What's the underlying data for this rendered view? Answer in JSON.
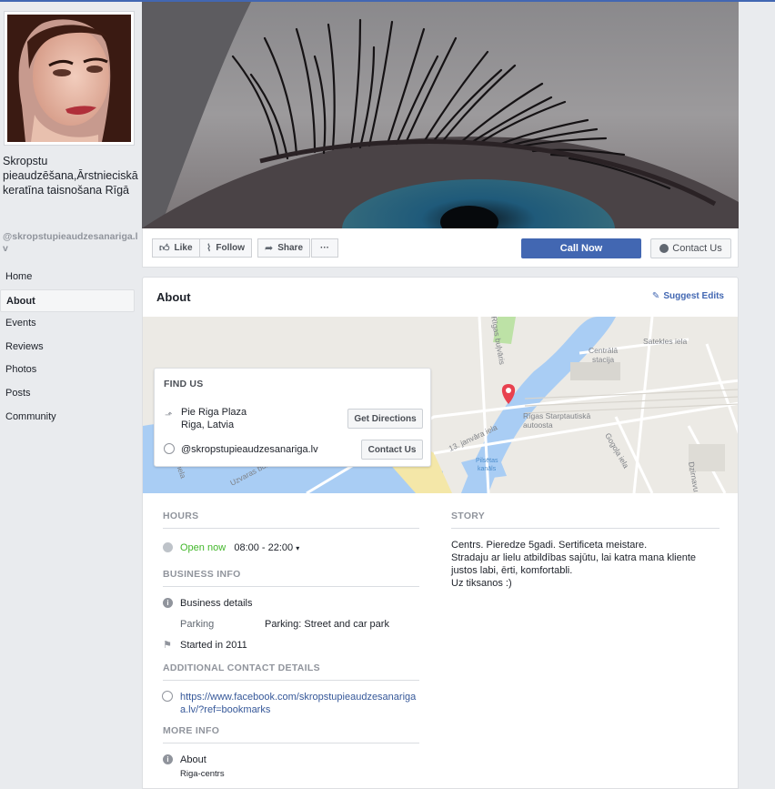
{
  "page": {
    "name": "Skropstu pieaudzēšana,Ārstnieciskā keratīna taisnošana Rīgā",
    "username": "@skropstupieaudzesanariga.lv"
  },
  "nav": [
    {
      "label": "Home",
      "active": false
    },
    {
      "label": "About",
      "active": true
    },
    {
      "label": "Events",
      "active": false
    },
    {
      "label": "Reviews",
      "active": false
    },
    {
      "label": "Photos",
      "active": false
    },
    {
      "label": "Posts",
      "active": false
    },
    {
      "label": "Community",
      "active": false
    }
  ],
  "actions": {
    "like": "Like",
    "follow": "Follow",
    "share": "Share",
    "more": "···",
    "call_now": "Call Now",
    "contact_us": "Contact Us"
  },
  "about": {
    "title": "About",
    "suggest_edits": "Suggest Edits"
  },
  "map": {
    "labels": {
      "satekles": "Satekles iela",
      "centrala": "Centrālā",
      "stacija": "stacija",
      "rigas": "Rīgas buļvāris",
      "janvara": "13. janvāra iela",
      "autoosta1": "Rīgas Starptautiskā",
      "autoosta2": "autoosta",
      "gogola": "Gogoļa iela",
      "pilsetas1": "Pilsētas",
      "pilsetas2": "kanāls",
      "kugu": "Kuģu iela",
      "uzvaras": "Uzvaras bulvāris",
      "dzirnavu": "Dzirnavu"
    }
  },
  "find_us": {
    "title": "FIND US",
    "address_line1": "Pie Riga Plaza",
    "address_line2": "Riga, Latvia",
    "get_directions": "Get Directions",
    "messenger_handle": "@skropstupieaudzesanariga.lv",
    "contact_us": "Contact Us"
  },
  "hours": {
    "heading": "HOURS",
    "status": "Open now",
    "range": "08:00 - 22:00"
  },
  "business_info": {
    "heading": "BUSINESS INFO",
    "details_label": "Business details",
    "parking_label": "Parking",
    "parking_value": "Parking: Street and car park",
    "started": "Started in 2011"
  },
  "contact": {
    "heading": "ADDITIONAL CONTACT DETAILS",
    "url_line1": "https://www.facebook.com/skropstupieaudzesanariga",
    "url_line2": "a.lv/?ref=bookmarks"
  },
  "more_info": {
    "heading": "MORE INFO",
    "about_label": "About",
    "about_value": "Riga-centrs"
  },
  "story": {
    "heading": "STORY",
    "line1": "Centrs. Pieredze 5gadi. Sertificeta meistare.",
    "line2": "Stradaju ar lielu atbildības sajūtu, lai katra mana kliente",
    "line3": "justos labi, ērti, komfortabli.",
    "line4": "Uz tiksanos :)"
  },
  "colors": {
    "brand": "#4267b2",
    "open": "#42b72a",
    "pin": "#e8414f"
  }
}
